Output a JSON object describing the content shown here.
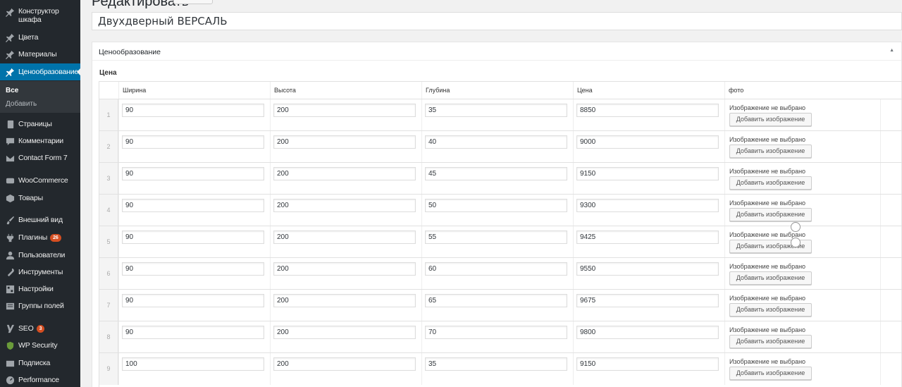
{
  "sidebar": {
    "items": [
      {
        "label": "Конструктор\nшкафа",
        "icon": "pin-icon"
      },
      {
        "label": "Цвета",
        "icon": "pin-icon"
      },
      {
        "label": "Материалы",
        "icon": "pin-icon"
      },
      {
        "label": "Ценообразование",
        "icon": "pin-icon",
        "current": true
      },
      {
        "label": "Страницы",
        "icon": "page-icon"
      },
      {
        "label": "Комментарии",
        "icon": "comment-icon"
      },
      {
        "label": "Contact Form 7",
        "icon": "mail-icon"
      },
      {
        "label": "WooCommerce",
        "icon": "woo-icon"
      },
      {
        "label": "Товары",
        "icon": "cube-icon"
      },
      {
        "label": "Внешний вид",
        "icon": "brush-icon"
      },
      {
        "label": "Плагины",
        "icon": "plug-icon",
        "badge": "26"
      },
      {
        "label": "Пользователи",
        "icon": "user-icon"
      },
      {
        "label": "Инструменты",
        "icon": "wrench-icon"
      },
      {
        "label": "Настройки",
        "icon": "settings-icon"
      },
      {
        "label": "Группы полей",
        "icon": "fields-icon"
      },
      {
        "label": "SEO",
        "icon": "yoast-icon",
        "badge": "3"
      },
      {
        "label": "WP Security",
        "icon": "shield-icon"
      },
      {
        "label": "Подписка",
        "icon": "newsletter-icon"
      },
      {
        "label": "Performance",
        "icon": "performance-icon"
      }
    ],
    "submenu": [
      {
        "label": "Все",
        "active": true
      },
      {
        "label": "Добавить"
      }
    ]
  },
  "header": {
    "heading": "Редактировать"
  },
  "post_title": "Двухдверный ВЕРСАЛЬ",
  "postbox": {
    "title": "Ценообразование",
    "field_label": "Цена",
    "columns": [
      "Ширина",
      "Высота",
      "Глубина",
      "Цена",
      "фото"
    ],
    "image_note": "Изображение не выбрано",
    "add_image_label": "Добавить изображение",
    "rows": [
      {
        "n": "1",
        "w": "90",
        "h": "200",
        "d": "35",
        "p": "8850"
      },
      {
        "n": "2",
        "w": "90",
        "h": "200",
        "d": "40",
        "p": "9000"
      },
      {
        "n": "3",
        "w": "90",
        "h": "200",
        "d": "45",
        "p": "9150"
      },
      {
        "n": "4",
        "w": "90",
        "h": "200",
        "d": "50",
        "p": "9300"
      },
      {
        "n": "5",
        "w": "90",
        "h": "200",
        "d": "55",
        "p": "9425"
      },
      {
        "n": "6",
        "w": "90",
        "h": "200",
        "d": "60",
        "p": "9550"
      },
      {
        "n": "7",
        "w": "90",
        "h": "200",
        "d": "65",
        "p": "9675"
      },
      {
        "n": "8",
        "w": "90",
        "h": "200",
        "d": "70",
        "p": "9800"
      },
      {
        "n": "9",
        "w": "100",
        "h": "200",
        "d": "35",
        "p": "9150"
      }
    ]
  },
  "colors": {
    "sidebar_bg": "#23282d",
    "accent": "#0073aa",
    "badge": "#d54e21"
  }
}
